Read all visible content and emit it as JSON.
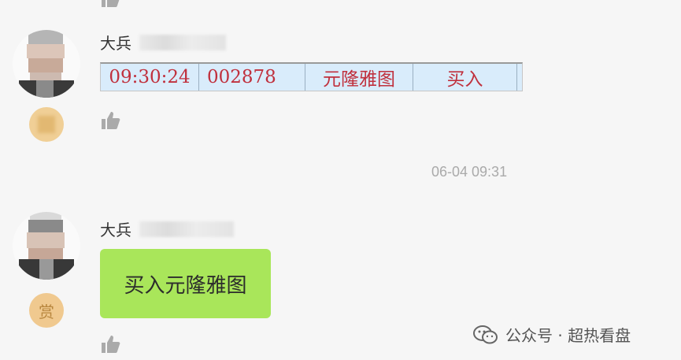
{
  "messages": [
    {
      "sender": "大兵",
      "trade": {
        "time": "09:30:24",
        "code": "002878",
        "name": "元隆雅图",
        "action": "买入"
      }
    },
    {
      "timestamp": "06-04 09:31"
    },
    {
      "sender": "大兵",
      "badge": "赏",
      "text": "买入元隆雅图"
    }
  ],
  "watermark": {
    "icon": "wechat-icon",
    "text": "公众号 · 超热看盘"
  },
  "colors": {
    "background": "#f6f6f6",
    "bubble_green": "#a9e65a",
    "trade_bg": "#d9ecfb",
    "trade_text": "#c0303d",
    "badge": "#f0c98f"
  }
}
